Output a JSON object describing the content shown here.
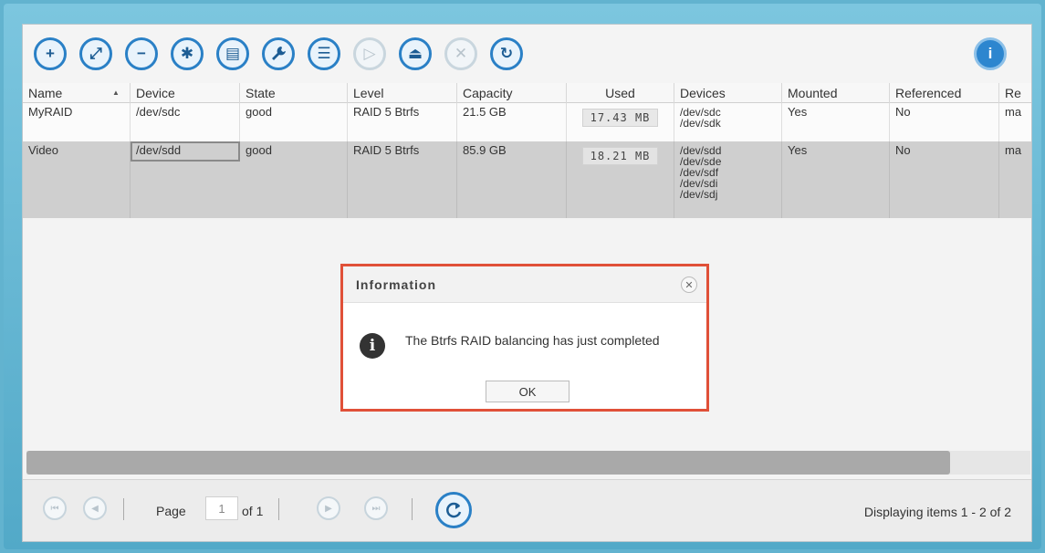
{
  "toolbar": {
    "buttons": [
      {
        "icon": "plus-icon",
        "glyph": "+"
      },
      {
        "icon": "expand-icon",
        "glyph": "⤢"
      },
      {
        "icon": "minus-icon",
        "glyph": "−"
      },
      {
        "icon": "puzzle-icon",
        "glyph": "✱"
      },
      {
        "icon": "database-icon",
        "glyph": "▤"
      },
      {
        "icon": "wrench-icon",
        "glyph": "🔧"
      },
      {
        "icon": "list-icon",
        "glyph": "☰"
      },
      {
        "icon": "play-icon",
        "glyph": "▷"
      },
      {
        "icon": "eject-icon",
        "glyph": "⏏"
      },
      {
        "icon": "close-icon",
        "glyph": "✕"
      },
      {
        "icon": "refresh-icon",
        "glyph": "↻"
      },
      {
        "icon": "info-icon",
        "glyph": "i"
      }
    ]
  },
  "grid": {
    "columns": [
      "Name",
      "Device",
      "State",
      "Level",
      "Capacity",
      "Used",
      "Devices",
      "Mounted",
      "Referenced",
      "Re"
    ],
    "rows": [
      {
        "name": "MyRAID",
        "device": "/dev/sdc",
        "state": "good",
        "level": "RAID 5 Btrfs",
        "capacity": "21.5 GB",
        "used": "17.43 MB",
        "devices": [
          "/dev/sdc",
          "/dev/sdk"
        ],
        "mounted": "Yes",
        "referenced": "No",
        "re": "ma"
      },
      {
        "name": "Video",
        "device": "/dev/sdd",
        "state": "good",
        "level": "RAID 5 Btrfs",
        "capacity": "85.9 GB",
        "used": "18.21 MB",
        "devices": [
          "/dev/sdd",
          "/dev/sde",
          "/dev/sdf",
          "/dev/sdi",
          "/dev/sdj"
        ],
        "mounted": "Yes",
        "referenced": "No",
        "re": "ma"
      }
    ]
  },
  "pager": {
    "page_label": "Page",
    "page_value": "1",
    "of_label": "of 1",
    "status": "Displaying items 1 - 2 of 2"
  },
  "dialog": {
    "title": "Information",
    "message": "The Btrfs RAID balancing has just completed",
    "ok_label": "OK",
    "border_color": "#e05038"
  }
}
